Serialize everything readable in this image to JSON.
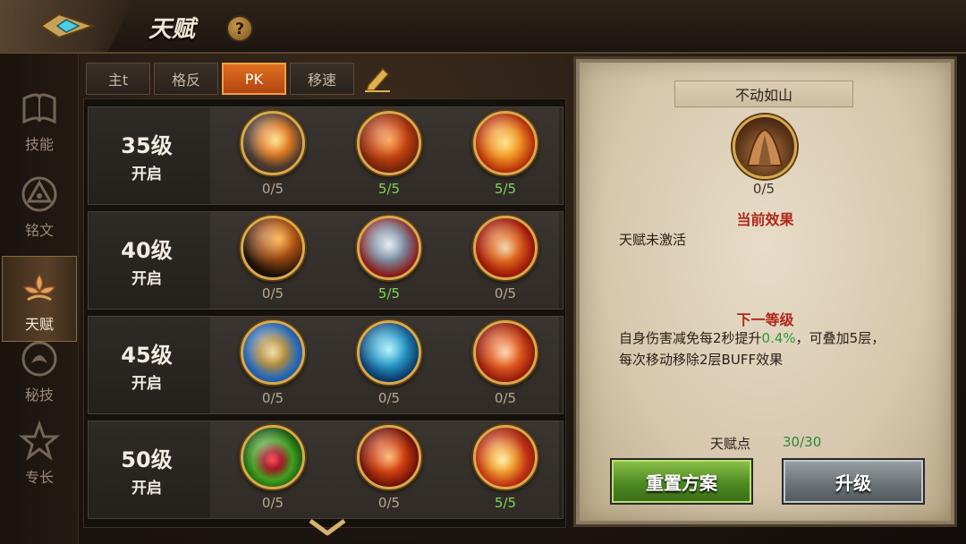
{
  "header": {
    "title": "天赋",
    "help": "?"
  },
  "nav": [
    {
      "label": "技能",
      "icon": "book-icon",
      "active": false
    },
    {
      "label": "铭文",
      "icon": "rune-icon",
      "active": false
    },
    {
      "label": "天赋",
      "icon": "talent-flower-icon",
      "active": true
    },
    {
      "label": "秘技",
      "icon": "secret-skill-icon",
      "active": false
    },
    {
      "label": "专长",
      "icon": "specialty-icon",
      "active": false
    }
  ],
  "tabs": [
    {
      "label": "主t",
      "active": false
    },
    {
      "label": "格反",
      "active": false
    },
    {
      "label": "PK",
      "active": true
    },
    {
      "label": "移速",
      "active": false
    }
  ],
  "tiers": [
    {
      "level": "35级",
      "open": "开启",
      "talents": [
        {
          "icon": "explosion-talent-icon",
          "progress": "0/5",
          "maxed": false
        },
        {
          "icon": "heart-hands-talent-icon",
          "progress": "5/5",
          "maxed": true
        },
        {
          "icon": "fire-swirl-talent-icon",
          "progress": "5/5",
          "maxed": true
        }
      ]
    },
    {
      "level": "40级",
      "open": "开启",
      "talents": [
        {
          "icon": "shadow-fist-talent-icon",
          "progress": "0/5",
          "maxed": false
        },
        {
          "icon": "armor-shard-talent-icon",
          "progress": "5/5",
          "maxed": true
        },
        {
          "icon": "flame-spear-talent-icon",
          "progress": "0/5",
          "maxed": false
        }
      ]
    },
    {
      "level": "45级",
      "open": "开启",
      "talents": [
        {
          "icon": "gold-shield-talent-icon",
          "progress": "0/5",
          "maxed": false
        },
        {
          "icon": "frost-warrior-talent-icon",
          "progress": "0/5",
          "maxed": false
        },
        {
          "icon": "blade-slash-talent-icon",
          "progress": "0/5",
          "maxed": false
        }
      ]
    },
    {
      "level": "50级",
      "open": "开启",
      "talents": [
        {
          "icon": "poison-heart-talent-icon",
          "progress": "0/5",
          "maxed": false
        },
        {
          "icon": "fire-demon-talent-icon",
          "progress": "0/5",
          "maxed": false
        },
        {
          "icon": "fire-strike-talent-icon",
          "progress": "5/5",
          "maxed": true
        }
      ]
    }
  ],
  "detail": {
    "name": "不动如山",
    "icon": "mountain-talent-icon",
    "progress": "0/5",
    "current_title": "当前效果",
    "current_text": "天赋未激活",
    "next_title": "下一等级",
    "next_text_pre": "自身伤害减免每2秒提升",
    "next_text_highlight": "0.4%",
    "next_text_post": "，可叠加5层，",
    "next_text_line2": "每次移动移除2层BUFF效果",
    "points_label": "天赋点",
    "points_value": "30/30",
    "reset_label": "重置方案",
    "upgrade_label": "升级"
  },
  "colors": {
    "maxed": "#7cd858",
    "unmaxed": "#b8a890",
    "tab_active": "#d05a18",
    "highlight": "#2a9a3a"
  }
}
